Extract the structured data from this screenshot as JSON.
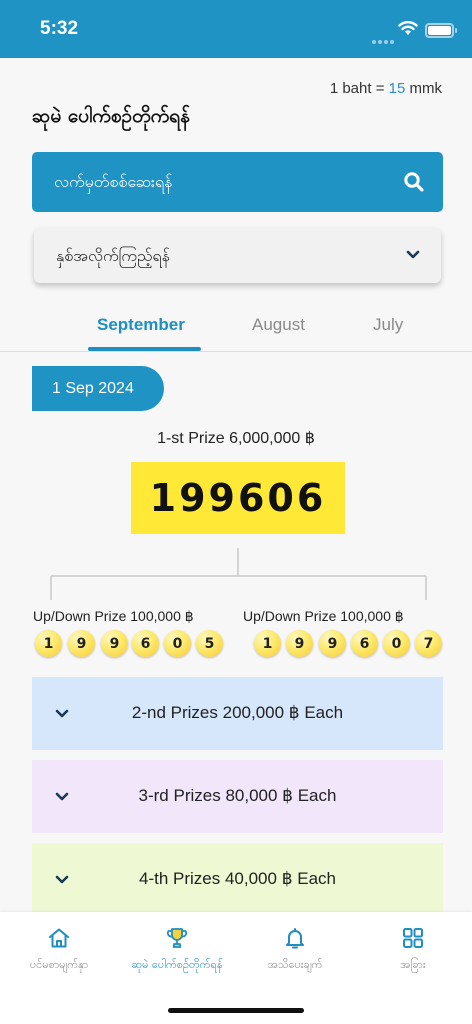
{
  "status_bar": {
    "time": "5:32"
  },
  "header": {
    "rate_prefix": "1 baht = ",
    "rate_value": "15",
    "rate_suffix": " mmk",
    "title": "ဆုမဲ ပေါက်စဉ်တိုက်ရန်"
  },
  "search": {
    "placeholder": "လက်မှတ်စစ်ဆေးရန်",
    "icon": "search-icon"
  },
  "year_select": {
    "label": "နှစ်အလိုက်ကြည့်ရန်",
    "icon": "chevron-down-icon"
  },
  "tabs": [
    {
      "label": "September",
      "active": true
    },
    {
      "label": "August",
      "active": false
    },
    {
      "label": "July",
      "active": false
    }
  ],
  "draw": {
    "date": "1 Sep 2024",
    "first_prize_label": "1-st Prize 6,000,000 ฿",
    "first_prize_number": "199606",
    "updown_left_label": "Up/Down Prize 100,000 ฿",
    "updown_right_label": "Up/Down Prize 100,000 ฿",
    "updown_left_digits": [
      "1",
      "9",
      "9",
      "6",
      "0",
      "5"
    ],
    "updown_right_digits": [
      "1",
      "9",
      "9",
      "6",
      "0",
      "7"
    ]
  },
  "prizes": [
    {
      "label": "2-nd Prizes 200,000 ฿ Each",
      "color": "#d6e7fc"
    },
    {
      "label": "3-rd Prizes 80,000 ฿ Each",
      "color": "#f1e6fa"
    },
    {
      "label": "4-th Prizes 40,000 ฿ Each",
      "color": "#eef9d4"
    }
  ],
  "bottom_nav": [
    {
      "label": "ပင်မစာမျက်နှာ",
      "icon": "home-icon",
      "active": false
    },
    {
      "label": "ဆုမဲ ပေါက်စဉ်တိုက်ရန်",
      "icon": "trophy-icon",
      "active": true
    },
    {
      "label": "အသိပေးချက်",
      "icon": "bell-icon",
      "active": false
    },
    {
      "label": "အခြား",
      "icon": "grid-icon",
      "active": false
    }
  ],
  "colors": {
    "primary": "#1f94c4",
    "tab_active": "#1e8fc0",
    "highlight": "#ffe936"
  }
}
